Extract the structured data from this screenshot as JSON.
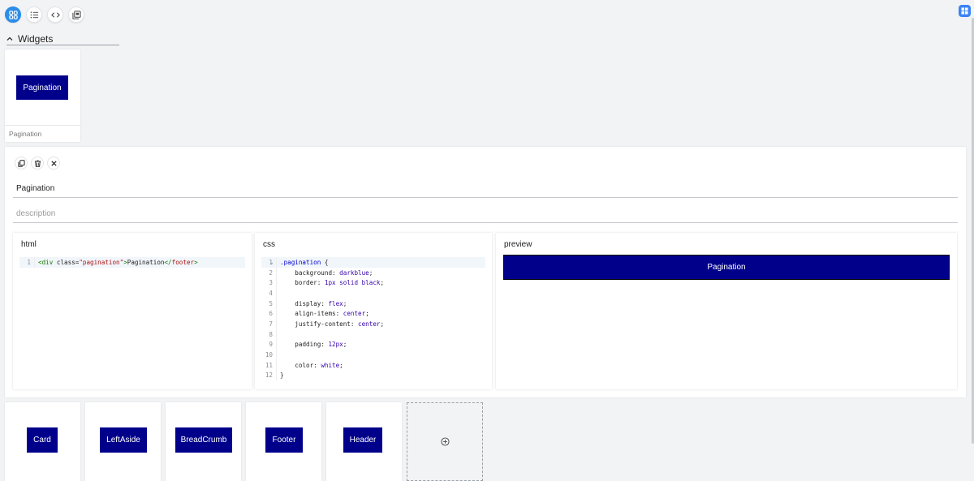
{
  "toolbar": {
    "buttons": [
      {
        "icon": "grid-icon",
        "active": true
      },
      {
        "icon": "list-icon",
        "active": false
      },
      {
        "icon": "code-icon",
        "active": false
      },
      {
        "icon": "copy-stack-icon",
        "active": false
      }
    ]
  },
  "section": {
    "title": "Widgets"
  },
  "selected_widget": {
    "preview_label": "Pagination",
    "caption": "Pagination"
  },
  "editor": {
    "name_value": "Pagination",
    "description_placeholder": "description",
    "html_pane": {
      "title": "html",
      "lines": [
        {
          "num": "1",
          "text": "<div class=\"pagination\">Pagination</footer>"
        }
      ]
    },
    "css_pane": {
      "title": "css",
      "lines": [
        {
          "num": "1",
          "text": ".pagination {"
        },
        {
          "num": "2",
          "text": "    background: darkblue;"
        },
        {
          "num": "3",
          "text": "    border: 1px solid black;"
        },
        {
          "num": "4",
          "text": ""
        },
        {
          "num": "5",
          "text": "    display: flex;"
        },
        {
          "num": "6",
          "text": "    align-items: center;"
        },
        {
          "num": "7",
          "text": "    justify-content: center;"
        },
        {
          "num": "8",
          "text": ""
        },
        {
          "num": "9",
          "text": "    padding: 12px;"
        },
        {
          "num": "10",
          "text": ""
        },
        {
          "num": "11",
          "text": "    color: white;"
        },
        {
          "num": "12",
          "text": "}"
        }
      ]
    },
    "preview_pane": {
      "title": "preview",
      "render_label": "Pagination"
    }
  },
  "widgets": [
    {
      "label": "Card"
    },
    {
      "label": "LeftAside"
    },
    {
      "label": "BreadCrumb"
    },
    {
      "label": "Footer"
    },
    {
      "label": "Header"
    }
  ],
  "colors": {
    "accent": "#2b8de8",
    "widget_bg": "#00008b"
  }
}
